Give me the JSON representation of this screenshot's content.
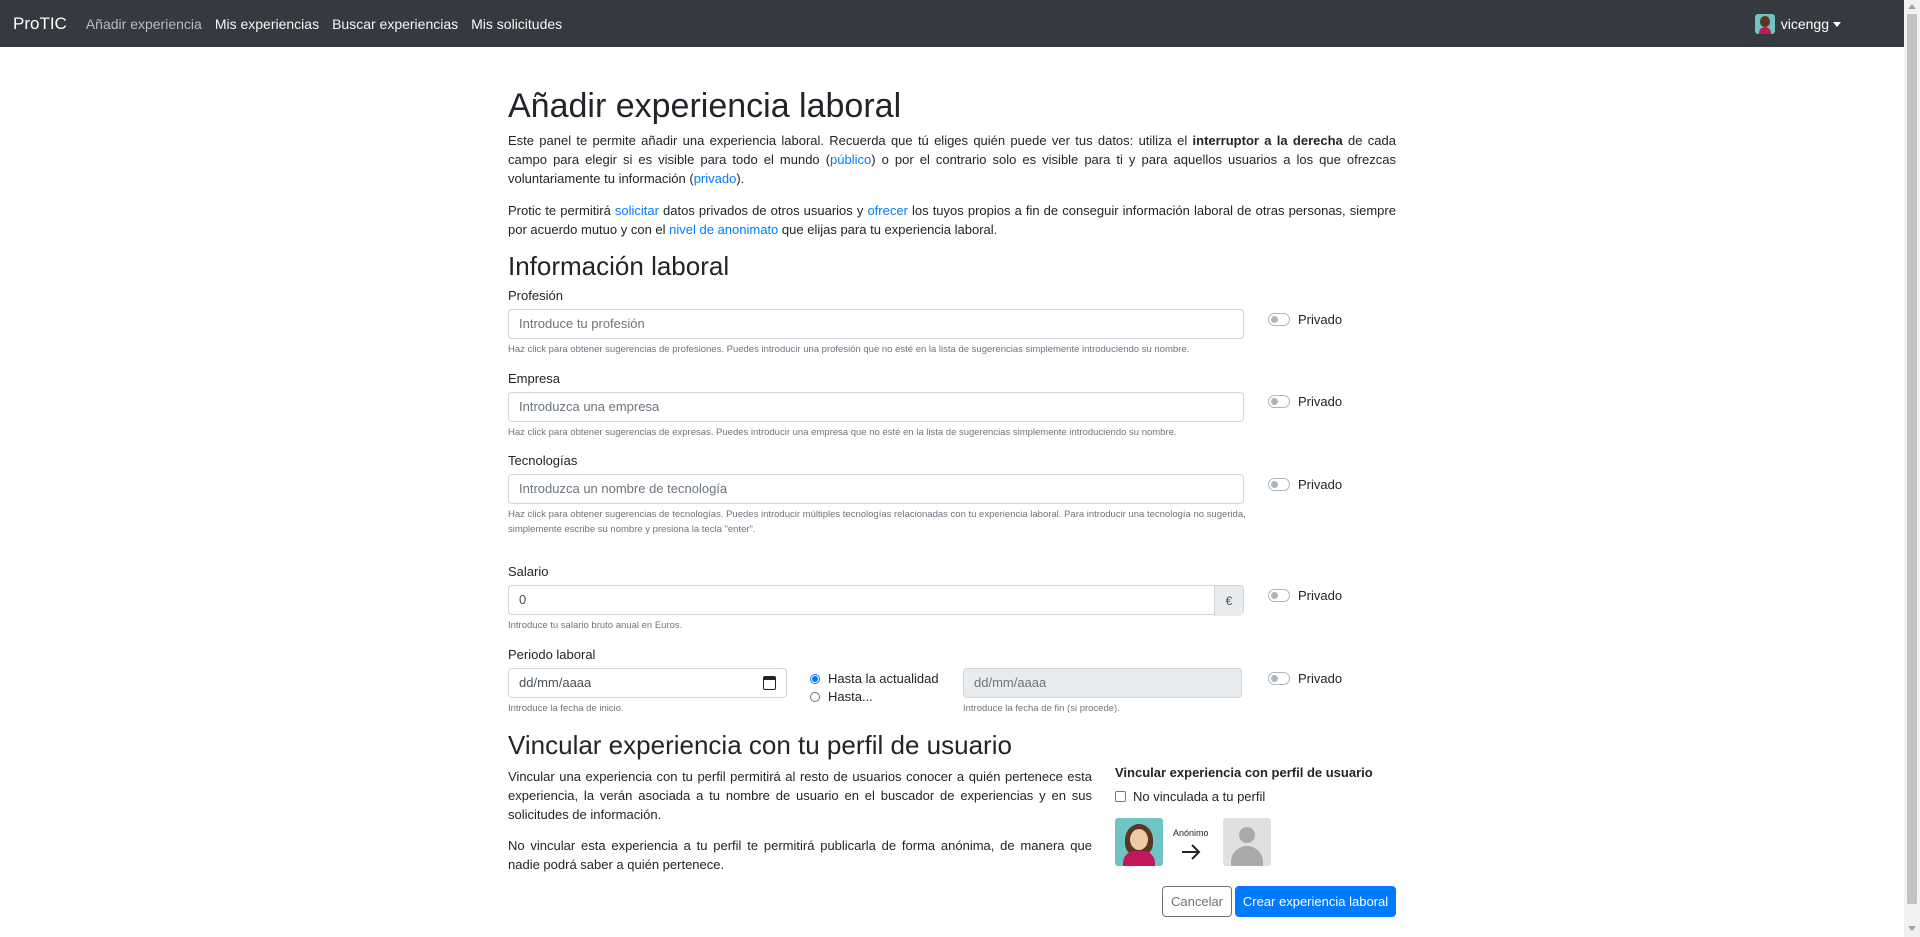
{
  "navbar": {
    "brand": "ProTIC",
    "links": [
      "Añadir experiencia",
      "Mis experiencias",
      "Buscar experiencias",
      "Mis solicitudes"
    ],
    "active_index": 0,
    "user": "vicengg"
  },
  "page": {
    "title": "Añadir experiencia laboral",
    "intro1": {
      "t1": "Este panel te permite añadir una experiencia laboral. Recuerda que tú eliges quién puede ver tus datos: utiliza el ",
      "bold": "interruptor a la derecha",
      "t2": " de cada campo para elegir si es visible para todo el mundo (",
      "link_publico": "público",
      "t3": ") o por el contrario solo es visible para ti y para aquellos usuarios a los que ofrezcas voluntariamente tu información (",
      "link_privado": "privado",
      "t4": ")."
    },
    "intro2": {
      "t1": "Protic te permitirá ",
      "link_solicitar": "solicitar",
      "t2": " datos privados de otros usuarios y ",
      "link_ofrecer": "ofrecer",
      "t3": " los tuyos propios a fin de conseguir información laboral de otras personas, siempre por acuerdo mutuo y con el ",
      "link_anonimato": "nivel de anonimato",
      "t4": " que elijas para tu experiencia laboral."
    }
  },
  "form": {
    "section_title": "Información laboral",
    "private_label": "Privado",
    "profesion": {
      "label": "Profesión",
      "placeholder": "Introduce tu profesión",
      "help": "Haz click para obtener sugerencias de profesiones. Puedes introducir una profesión que no esté en la lista de sugerencias simplemente introduciendo su nombre."
    },
    "empresa": {
      "label": "Empresa",
      "placeholder": "Introduzca una empresa",
      "help": "Haz click para obtener sugerencias de expresas. Puedes introducir una empresa que no esté en la lista de sugerencias simplemente introduciendo su nombre."
    },
    "tecnologias": {
      "label": "Tecnologías",
      "placeholder": "Introduzca un nombre de tecnología",
      "help": "Haz click para obtener sugerencias de tecnologías. Puedes introducir múltiples tecnologías relacionadas con tu experiencia laboral. Para introducir una tecnología no sugerida, simplemente escribe su nombre y presiona la tecla \"enter\"."
    },
    "salario": {
      "label": "Salario",
      "value": "0",
      "currency": "€",
      "help": "Introduce tu salario bruto anual en Euros."
    },
    "periodo": {
      "label": "Periodo laboral",
      "start_placeholder": "dd/mm/aaaa",
      "start_help": "Introduce la fecha de inicio.",
      "option_current": "Hasta la actualidad",
      "option_until": "Hasta...",
      "selected_option": "Hasta la actualidad",
      "end_placeholder": "dd/mm/aaaa",
      "end_help": "Introduce la fecha de fin (si procede)."
    }
  },
  "vincular": {
    "title": "Vincular experiencia con tu perfil de usuario",
    "p1": "Vincular una experiencia con tu perfil permitirá al resto de usuarios conocer a quién pertenece esta experiencia, la verán asociada a tu nombre de usuario en el buscador de experiencias y en sus solicitudes de información.",
    "p2": "No vincular esta experiencia a tu perfil te permitirá publicarla de forma anónima, de manera que nadie podrá saber a quién pertenece.",
    "box_title": "Vincular experiencia con perfil de usuario",
    "checkbox_label": "No vinculada a tu perfil",
    "anon_label": "Anónimo"
  },
  "actions": {
    "cancel": "Cancelar",
    "submit": "Crear experiencia laboral"
  },
  "colors": {
    "navbar": "#343a40",
    "link": "#007bff",
    "primary": "#007bff"
  }
}
